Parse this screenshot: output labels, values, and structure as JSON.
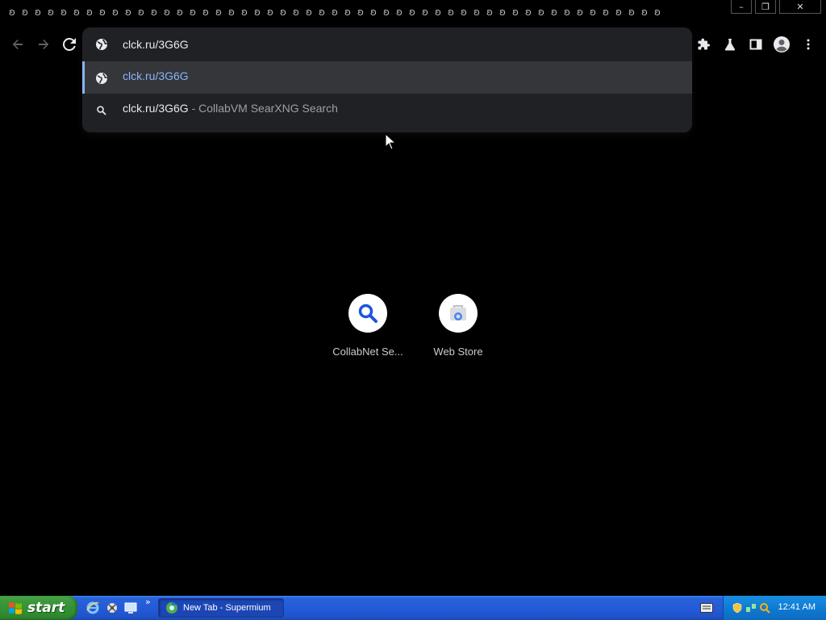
{
  "window": {
    "tab_glyph": "ʚ",
    "tab_count": 51,
    "controls": {
      "minimize": "–",
      "restore": "❐",
      "close": "✕"
    }
  },
  "toolbar": {
    "icons": [
      "back-arrow-icon",
      "forward-arrow-icon",
      "reload-icon",
      "extensions-icon",
      "labs-flask-icon",
      "side-panel-icon",
      "profile-icon",
      "menu-icon"
    ]
  },
  "omnibox": {
    "value": "clck.ru/3G6G",
    "suggestions": [
      {
        "text": "clck.ru/3G6G",
        "desc": "",
        "icon": "globe-icon",
        "selected": true
      },
      {
        "text": "clck.ru/3G6G",
        "desc": " - CollabVM SearXNG Search",
        "icon": "search-icon",
        "selected": false
      }
    ]
  },
  "shortcuts": [
    {
      "label": "CollabNet Se...",
      "icon": "search-magnifier-icon"
    },
    {
      "label": "Web Store",
      "icon": "web-store-icon"
    }
  ],
  "taskbar": {
    "start_label": "start",
    "more": "»",
    "task_button": "New Tab - Supermium",
    "clock": "12:41 AM"
  },
  "colors": {
    "accent_link": "#8ab4f8",
    "omnibox_bg": "#202124",
    "selected_row": "#35363a",
    "taskbar_blue": "#235bd8",
    "start_green": "#3c9a3c"
  }
}
